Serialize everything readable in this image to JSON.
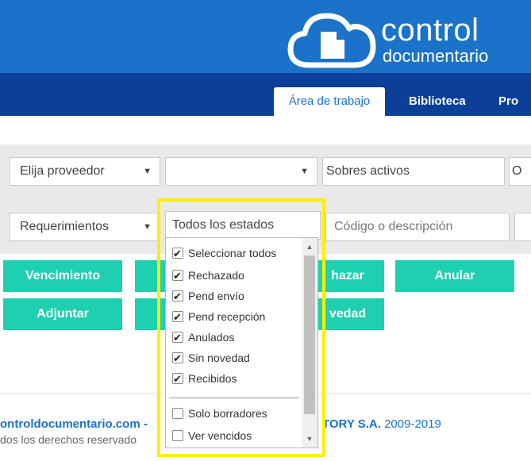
{
  "header": {
    "logo": {
      "word1": "control",
      "word2": "documentario",
      "icon": "cloud-document-icon"
    },
    "colors": {
      "header_bg": "#1a72c9",
      "nav_bg": "#0b3f98",
      "accent_button": "#1ecfb0",
      "highlight": "#ffef00"
    }
  },
  "nav": {
    "tabs": [
      {
        "label": "Área de trabajo",
        "active": true
      },
      {
        "label": "Biblioteca",
        "active": false
      },
      {
        "label": "Pro",
        "active": false
      }
    ]
  },
  "filters": {
    "row1": {
      "provider": "Elija proveedor",
      "blank_select": "",
      "envelopes": "Sobres activos",
      "clipped": "O"
    },
    "row2": {
      "requirements": "Requerimientos",
      "states": "Todos los estados",
      "search_placeholder": "Código o descripción"
    }
  },
  "buttons": {
    "vencimiento": "Vencimiento",
    "rechazar_partial": "hazar",
    "anular": "Anular",
    "adjuntar": "Adjuntar",
    "novedad_partial": "vedad"
  },
  "dropdown": {
    "options": [
      {
        "label": "Seleccionar todos",
        "checked": true
      },
      {
        "label": "Rechazado",
        "checked": true
      },
      {
        "label": "Pend envío",
        "checked": true
      },
      {
        "label": "Pend recepción",
        "checked": true
      },
      {
        "label": "Anulados",
        "checked": true
      },
      {
        "label": "Sin novedad",
        "checked": true
      },
      {
        "label": "Recibidos",
        "checked": true
      }
    ],
    "extra_options": [
      {
        "label": "Solo borradores",
        "checked": false
      },
      {
        "label": "Ver vencidos",
        "checked": false
      }
    ]
  },
  "footer": {
    "site": "ontroldocumentario.com -",
    "company_partial": "TORY S.A.",
    "years": "2009-2019",
    "rights": "dos los derechos reservado"
  }
}
